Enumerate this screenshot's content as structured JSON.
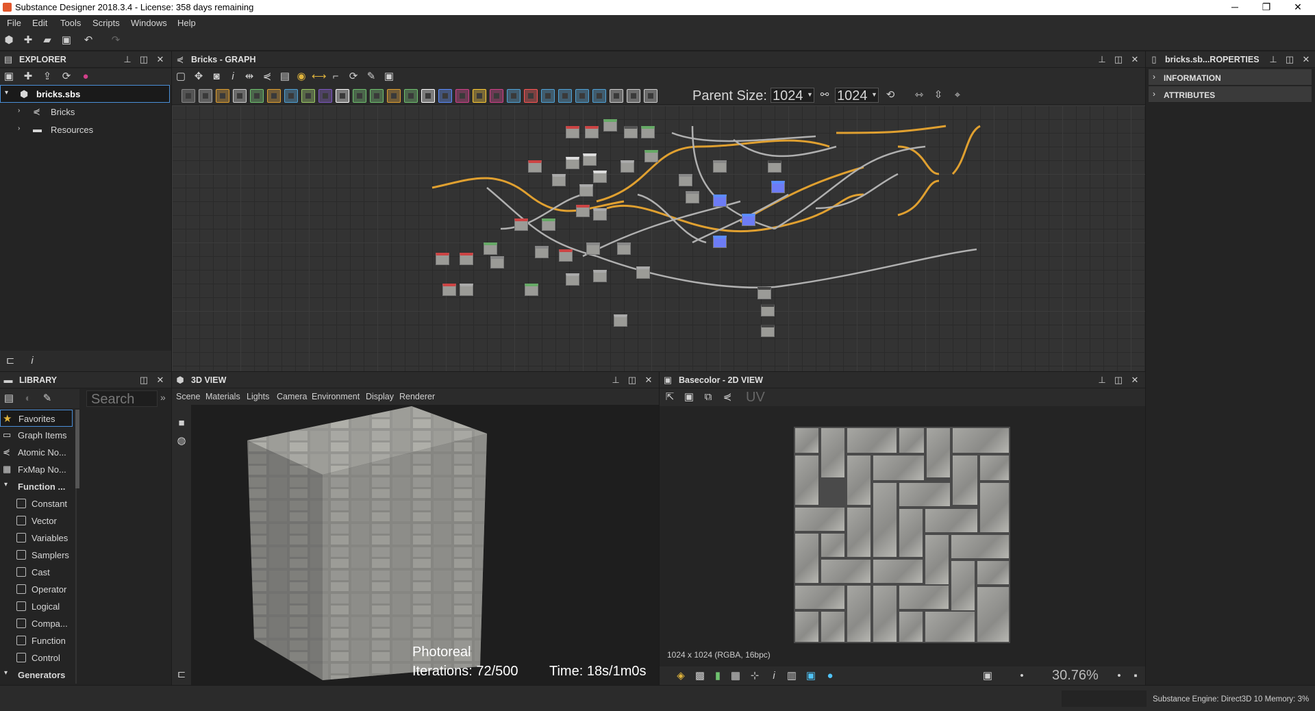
{
  "window": {
    "title": "Substance Designer 2018.3.4 - License: 358 days remaining",
    "controls": [
      "─",
      "❐",
      "✕"
    ]
  },
  "menu": [
    "File",
    "Edit",
    "Tools",
    "Scripts",
    "Windows",
    "Help"
  ],
  "explorer": {
    "title": "EXPLORER",
    "package": "bricks.sbs",
    "items": [
      "Bricks",
      "Resources"
    ]
  },
  "graph": {
    "title": "Bricks - GRAPH",
    "parent_size_label": "Parent Size:",
    "size_a": "1024",
    "size_b": "1024"
  },
  "properties": {
    "title": "bricks.sb...ROPERTIES",
    "sections": [
      "INFORMATION",
      "ATTRIBUTES"
    ]
  },
  "library": {
    "title": "LIBRARY",
    "search_placeholder": "Search",
    "categories": [
      "Favorites",
      "Graph Items",
      "Atomic No...",
      "FxMap No..."
    ],
    "function_group": "Function ...",
    "function_items": [
      "Constant",
      "Vector",
      "Variables",
      "Samplers",
      "Cast",
      "Operator",
      "Logical",
      "Compa...",
      "Function",
      "Control"
    ],
    "generators_group": "Generators"
  },
  "view3d": {
    "title": "3D VIEW",
    "tabs": [
      "Scene",
      "Materials",
      "Lights",
      "Camera",
      "Environment",
      "Display",
      "Renderer"
    ],
    "render_mode": "Photoreal",
    "iterations": "Iterations: 72/500",
    "time": "Time: 18s/1m0s"
  },
  "view2d": {
    "title": "Basecolor - 2D VIEW",
    "uv_label": "UV",
    "info": "1024 x 1024 (RGBA, 16bpc)",
    "zoom": "30.76%"
  },
  "status": {
    "engine": "Substance Engine: Direct3D 10  Memory: 3%"
  }
}
